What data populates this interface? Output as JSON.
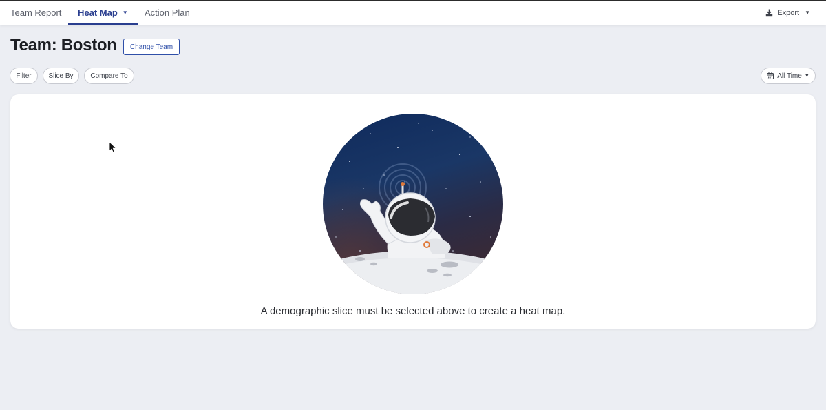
{
  "nav": {
    "tabs": [
      {
        "label": "Team Report"
      },
      {
        "label": "Heat Map"
      },
      {
        "label": "Action Plan"
      }
    ],
    "active_tab": "Heat Map",
    "export_label": "Export"
  },
  "header": {
    "title": "Team: Boston",
    "change_team_label": "Change Team"
  },
  "filters": {
    "filter_label": "Filter",
    "slice_by_label": "Slice By",
    "compare_to_label": "Compare To",
    "time_range_label": "All Time"
  },
  "empty_state": {
    "message": "A demographic slice must be selected above to create a heat map.",
    "illustration": "astronaut-on-moon"
  },
  "colors": {
    "accent": "#2a3e8f",
    "background": "#eceef3",
    "card": "#ffffff"
  }
}
